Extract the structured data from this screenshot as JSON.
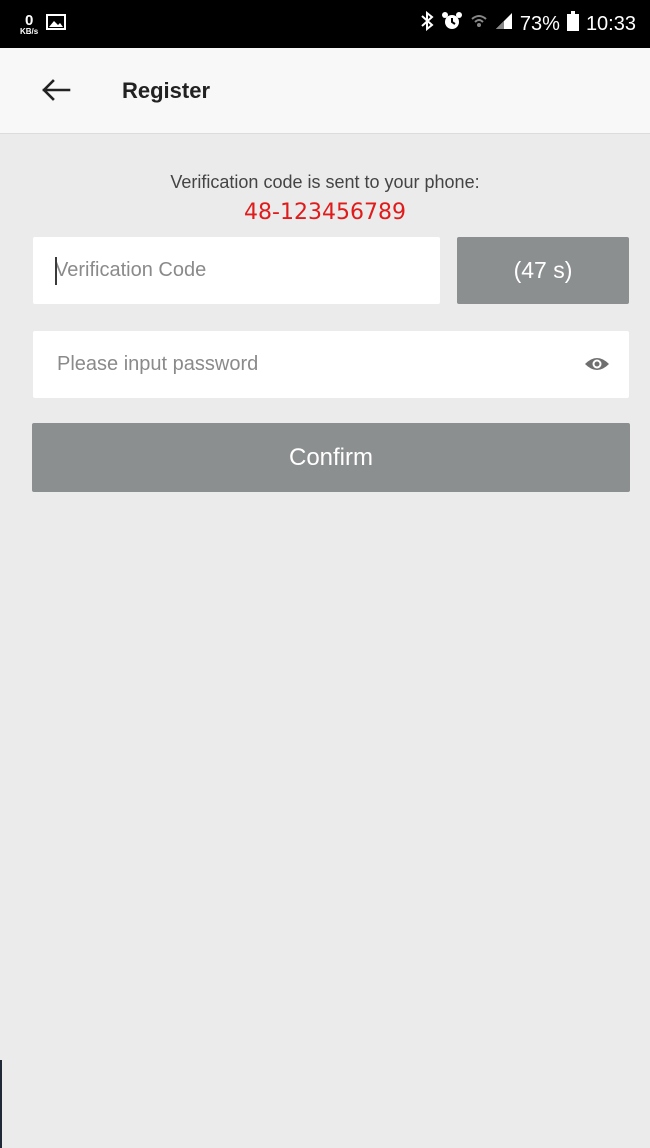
{
  "status_bar": {
    "net_speed": "0",
    "net_unit": "KB/s",
    "battery": "73%",
    "time": "10:33",
    "icons": [
      "image-icon",
      "bluetooth-icon",
      "alarm-icon",
      "wifi-icon",
      "signal-icon",
      "battery-icon"
    ]
  },
  "header": {
    "back_icon": "arrow-left-icon",
    "title": "Register"
  },
  "verification": {
    "message": "Verification code is sent to your phone:",
    "phone_number": "48-123456789",
    "code_placeholder": "Verification Code",
    "code_value": "",
    "timer_label": "(47 s)"
  },
  "password": {
    "placeholder": "Please input password",
    "value": "",
    "toggle_icon": "eye-icon"
  },
  "actions": {
    "confirm_label": "Confirm"
  },
  "colors": {
    "status_bar": "#000000",
    "app_bar": "#f8f8f8",
    "background": "#ebebeb",
    "button_gray": "#8c8f90",
    "phone_red": "#e01b1b"
  }
}
